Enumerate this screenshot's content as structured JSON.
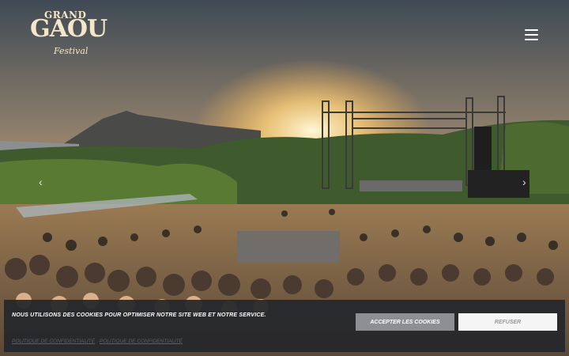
{
  "logo": {
    "line1": "GRAND",
    "line2": "GAOU",
    "line3": "Festival"
  },
  "nav": {
    "menu_icon": "hamburger-icon"
  },
  "slider": {
    "prev_icon": "chevron-left-icon",
    "next_icon": "chevron-right-icon",
    "prev": "‹",
    "next": "›"
  },
  "cookie": {
    "message": "Nous utilisons des cookies pour optimiser notre site web et notre service.",
    "accept_label": "Accepter les cookies",
    "refuse_label": "Refuser",
    "links": [
      "Politique de confidentialité",
      "Politique de confidentialité"
    ]
  },
  "colors": {
    "logo": "#f3e6c9",
    "banner_bg": "#25272c",
    "accept_bg": "#8e8f92",
    "refuse_bg": "#f5f5f5"
  }
}
